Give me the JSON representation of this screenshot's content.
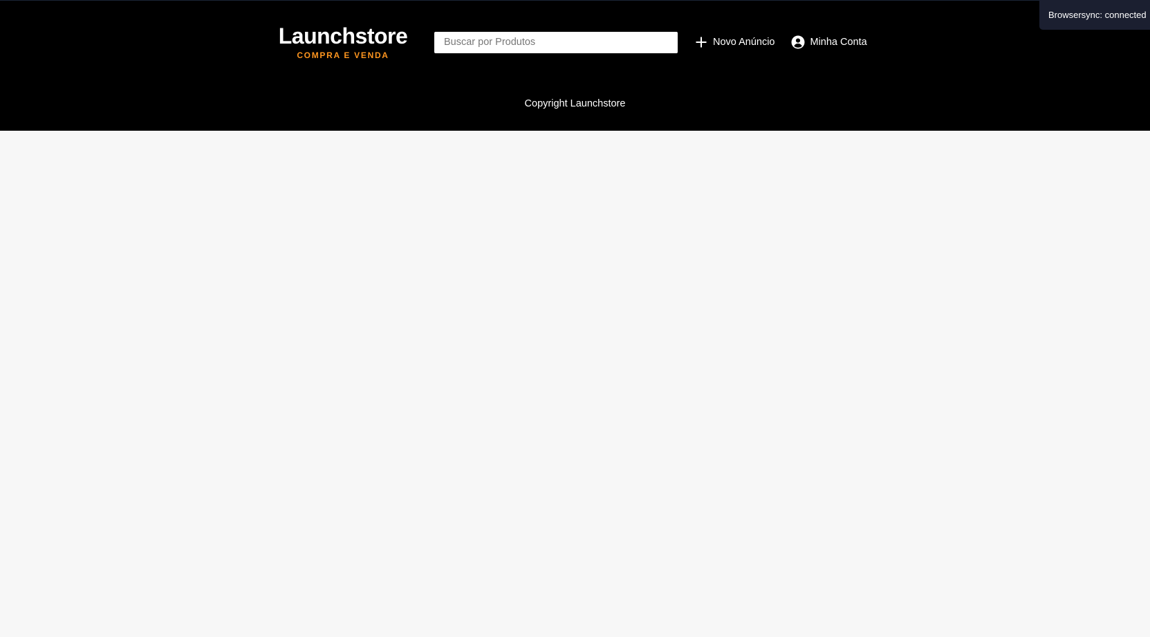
{
  "header": {
    "logo": {
      "title": "Launchstore",
      "tagline": "COMPRA E VENDA"
    },
    "search": {
      "placeholder": "Buscar por Produtos",
      "value": ""
    },
    "nav": {
      "new_ad": {
        "label": "Novo Anúncio",
        "icon": "plus-icon"
      },
      "account": {
        "label": "Minha Conta",
        "icon": "account-circle-icon"
      }
    }
  },
  "footer": {
    "copyright": "Copyright Launchstore"
  },
  "notification": {
    "text": "Browsersync: connected"
  },
  "colors": {
    "header_bg": "#000000",
    "page_bg": "#f7f7f7",
    "accent": "#fd951f",
    "notification_bg": "#1b1f30"
  }
}
